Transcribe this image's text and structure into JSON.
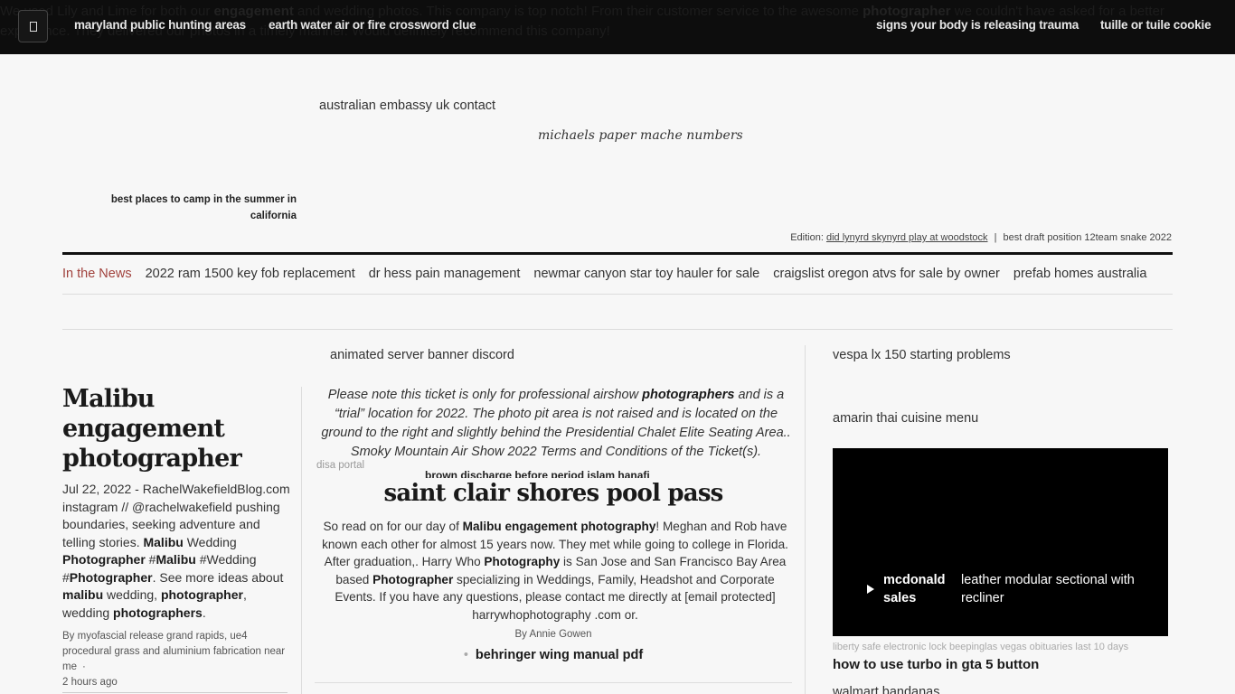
{
  "topbar": {
    "background_text_html_parts": [
      {
        "t": "We used Lily and Lime for both our "
      },
      {
        "b": "engagement"
      },
      {
        "t": " and wedding photos. This company is top notch! From their customer service to the awesome "
      },
      {
        "b": "photographer"
      },
      {
        "t": " we couldn't have asked for a better experience. They delivered our photos in a timely manner. Would definitely recommend this company!"
      }
    ],
    "menu_icon": "menu-icon",
    "links": [
      "maryland public hunting areas",
      "earth water air or fire crossword clue",
      "signs your body is releasing trauma",
      "tuille or tuile cookie"
    ]
  },
  "masthead": {
    "link_a": "australian embassy uk contact",
    "link_b": "michaels paper mache numbers",
    "link_c": "best places to camp in the summer in california",
    "edition_label": "Edition:",
    "edition_link": "did lynyrd skynyrd play at woodstock",
    "edition_separator": "|",
    "edition_extra": "best draft position 12team snake 2022"
  },
  "nav": {
    "items": [
      "In the News",
      "2022 ram 1500 key fob replacement",
      "dr hess pain management",
      "newmar canyon star toy hauler for sale",
      "craigslist oregon atvs for sale by owner",
      "prefab homes australia"
    ],
    "accent_color": "#a0413c"
  },
  "left": {
    "headline": "Malibu engagement photographer",
    "body_parts": [
      {
        "t": "Jul 22, 2022 - RachelWakefieldBlog.com instagram // @rachelwakefield pushing boundaries, seeking adventure and telling stories. "
      },
      {
        "b": "Malibu"
      },
      {
        "t": " Wedding "
      },
      {
        "b": "Photographer"
      },
      {
        "t": " #"
      },
      {
        "b": "Malibu"
      },
      {
        "t": " #Wedding #"
      },
      {
        "b": "Photographer"
      },
      {
        "t": ". See more ideas about "
      },
      {
        "b": "malibu"
      },
      {
        "t": " wedding, "
      },
      {
        "b": "photographer"
      },
      {
        "t": ", wedding "
      },
      {
        "b": "photographers"
      },
      {
        "t": "."
      }
    ],
    "byline": "By myofascial release grand rapids, ue4 procedural grass and aluminium fabrication near me",
    "byline_dot": "·",
    "time": "2 hours ago"
  },
  "center": {
    "top_link": "animated server banner discord",
    "italic_parts": [
      {
        "t": "Please note this ticket is only for professional airshow "
      },
      {
        "b": "photographers"
      },
      {
        "t": " and is a “trial” location for 2022. The photo pit area is not raised and is located on the ground to the right and slightly behind the Presidential Chalet Elite Seating Area.. Smoky Mountain Air Show 2022 Terms and Conditions of the Ticket(s)."
      }
    ],
    "small_link": "disa portal",
    "clipped_title": "brown discharge before period islam hanafi",
    "headline": "saint clair shores pool pass",
    "body_parts": [
      {
        "t": "So read on for our day of "
      },
      {
        "b": "Malibu engagement photography"
      },
      {
        "t": "! Meghan and Rob have known each other for almost 15 years now. They met while going to college in Florida. After graduation,. Harry Who "
      },
      {
        "b": "Photography"
      },
      {
        "t": " is San Jose and San Francisco Bay Area based "
      },
      {
        "b": "Photographer"
      },
      {
        "t": " specializing in Weddings, Family, Headshot and Corporate Events. If you have any questions, please contact me directly at [email protected] harrywhophotography .com or."
      }
    ],
    "byline": "By Annie Gowen",
    "bullet": "•",
    "bullet_link": "behringer wing manual pdf"
  },
  "right": {
    "link_1": "vespa lx 150 starting problems",
    "link_2": "amarin thai cuisine menu",
    "video": {
      "play_icon": "play-icon",
      "title": "mcdonald sales",
      "description": "leather modular sectional with recliner"
    },
    "caption": "liberty safe electronic lock beepinglas vegas obituaries last 10 days",
    "bold_link": "how to use turbo in gta 5 button",
    "clipped_link": "walmart bandanas"
  }
}
